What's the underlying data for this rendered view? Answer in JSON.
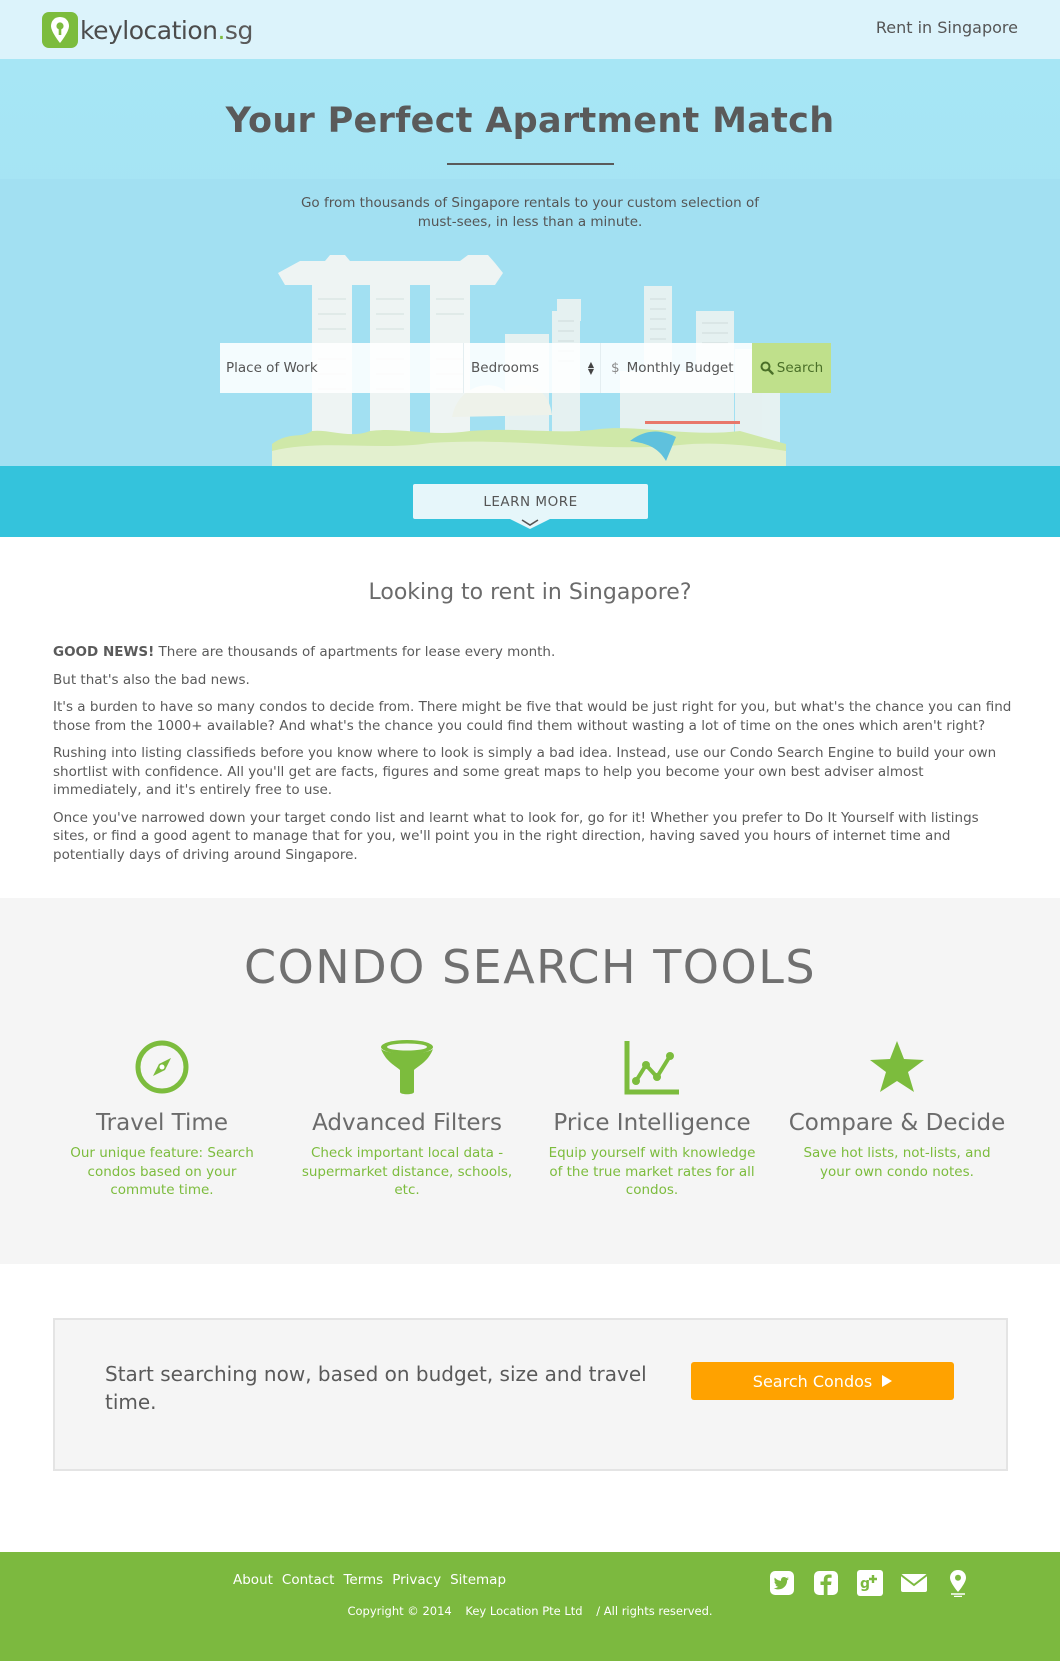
{
  "header": {
    "logo_text_main": "keylocation",
    "logo_text_dot": ".",
    "logo_text_tld": "sg",
    "nav_link": "Rent in Singapore"
  },
  "hero": {
    "title": "Your Perfect Apartment Match",
    "subtitle": "Go from thousands of Singapore rentals to your custom selection of must-sees, in less than a minute.",
    "search": {
      "place_placeholder": "Place of Work",
      "bedrooms_label": "Bedrooms",
      "currency_symbol": "$",
      "budget_label": "Monthly Budget",
      "button_label": "Search"
    },
    "learn_more": "LEARN MORE"
  },
  "intro": {
    "title": "Looking to rent in Singapore?",
    "p1_bold": "GOOD NEWS!",
    "p1_rest": " There are thousands of apartments for lease every month.",
    "p2": "But that's also the bad news.",
    "p3": "It's a burden to have so many condos to decide from. There might be five that would be just right for you, but what's the chance you can find those from the 1000+ available? And what's the chance you could find them without wasting a lot of time on the ones which aren't right?",
    "p4": "Rushing into listing classifieds before you know where to look is simply a bad idea. Instead, use our Condo Search Engine to build your own shortlist with confidence. All you'll get are facts, figures and some great maps to help you become your own best adviser almost immediately, and it's entirely free to use.",
    "p5": "Once you've narrowed down your target condo list and learnt what to look for, go for it! Whether you prefer to Do It Yourself with listings sites, or find a good agent to manage that for you, we'll point you in the right direction, having saved you hours of internet time and potentially days of driving around Singapore."
  },
  "tools": {
    "title": "CONDO SEARCH TOOLS",
    "items": [
      {
        "icon": "compass-icon",
        "name": "Travel Time",
        "desc": "Our unique feature: Search condos based on your commute time."
      },
      {
        "icon": "funnel-icon",
        "name": "Advanced Filters",
        "desc": "Check important local data - supermarket distance, schools, etc."
      },
      {
        "icon": "line-chart-icon",
        "name": "Price Intelligence",
        "desc": "Equip yourself with knowledge of the true market rates for all condos."
      },
      {
        "icon": "star-icon",
        "name": "Compare & Decide",
        "desc": "Save hot lists, not-lists, and your own condo notes."
      }
    ]
  },
  "cta": {
    "text": "Start searching now, based on budget, size and travel time.",
    "button": "Search Condos"
  },
  "footer": {
    "links": [
      "About",
      "Contact",
      "Terms",
      "Privacy",
      "Sitemap"
    ],
    "copyright": "Copyright © 2014",
    "company": "Key Location Pte Ltd",
    "rights": "/ All rights reserved.",
    "social": [
      "twitter-icon",
      "facebook-icon",
      "google-plus-icon",
      "mail-icon",
      "map-pin-icon"
    ]
  },
  "colors": {
    "brand_green": "#7cbc3d",
    "hero_sky": "#a7e6f5",
    "band_blue": "#34c3dc",
    "cta_orange": "#ffa200",
    "search_button": "#bfe08b",
    "footer_green": "#7cb93f"
  }
}
